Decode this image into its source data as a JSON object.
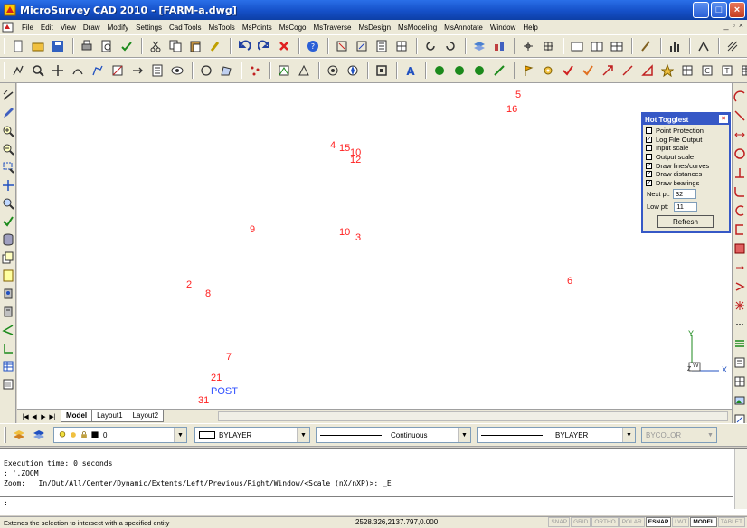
{
  "window": {
    "title": "MicroSurvey CAD 2010 - [FARM-a.dwg]",
    "minimize": "_",
    "maximize": "□",
    "close": "×"
  },
  "menu": [
    "File",
    "Edit",
    "View",
    "Draw",
    "Modify",
    "Settings",
    "Cad Tools",
    "MsTools",
    "MsPoints",
    "MsCogo",
    "MsTraverse",
    "MsDesign",
    "MsModeling",
    "MsAnnotate",
    "Window",
    "Help"
  ],
  "mdi_controls": {
    "minimize": "_",
    "restore": "▫",
    "close": "×"
  },
  "canvas": {
    "points": [
      {
        "label": "5",
        "color": "#ff2020"
      },
      {
        "label": "16",
        "color": "#ff2020"
      },
      {
        "label": "4",
        "color": "#ff2020"
      },
      {
        "label": "15",
        "color": "#ff2020"
      },
      {
        "label": "10",
        "color": "#ff2020"
      },
      {
        "label": "12",
        "color": "#ff2020"
      },
      {
        "label": "9",
        "color": "#ff2020"
      },
      {
        "label": "10",
        "color": "#ff2020"
      },
      {
        "label": "3",
        "color": "#ff2020"
      },
      {
        "label": "2",
        "color": "#ff2020"
      },
      {
        "label": "8",
        "color": "#ff2020"
      },
      {
        "label": "6",
        "color": "#ff2020"
      },
      {
        "label": "7",
        "color": "#ff2020"
      },
      {
        "label": "21",
        "color": "#ff2020"
      },
      {
        "label": "POST",
        "color": "#3050ff"
      },
      {
        "label": "31",
        "color": "#ff2020"
      }
    ],
    "ucs": {
      "y_label": "Y",
      "x_label": "X",
      "w_label": "W",
      "z_label": "Z"
    }
  },
  "tabs": {
    "nav": [
      "|◀",
      "◀",
      "▶",
      "▶|"
    ],
    "items": [
      "Model",
      "Layout1",
      "Layout2"
    ],
    "active": "Model"
  },
  "properties": {
    "layer": "0",
    "color": "BYLAYER",
    "linetype": "Continuous",
    "lineweight": "BYLAYER",
    "plotstyle": "BYCOLOR"
  },
  "command": {
    "lines": [
      "Execution time: 0 seconds",
      ": '.ZOOM",
      "Zoom:   In/Out/All/Center/Dynamic/Extents/Left/Previous/Right/Window/<Scale (nX/nXP)>: _E"
    ],
    "prompt": ":"
  },
  "status": {
    "message": "Extends the selection to intersect with a specified entity",
    "coordinates": "2528.326,2137.797,0.000",
    "buttons": [
      {
        "label": "SNAP",
        "on": false
      },
      {
        "label": "GRID",
        "on": false
      },
      {
        "label": "ORTHO",
        "on": false
      },
      {
        "label": "POLAR",
        "on": false
      },
      {
        "label": "ESNAP",
        "on": true
      },
      {
        "label": "LWT",
        "on": false
      },
      {
        "label": "MODEL",
        "on": true
      },
      {
        "label": "TABLET",
        "on": false
      }
    ]
  },
  "palette": {
    "title": "Hot Togglest",
    "close": "×",
    "options": [
      {
        "label": "Point Protection",
        "checked": false
      },
      {
        "label": "Log File Output",
        "checked": true
      },
      {
        "label": "Input scale",
        "checked": false
      },
      {
        "label": "Output scale",
        "checked": false
      },
      {
        "label": "Draw lines/curves",
        "checked": true
      },
      {
        "label": "Draw distances",
        "checked": true
      },
      {
        "label": "Draw bearings",
        "checked": true
      }
    ],
    "next_pt_label": "Next pt:",
    "next_pt_value": "32",
    "low_pt_label": "Low pt:",
    "low_pt_value": "11",
    "refresh_label": "Refresh"
  },
  "check_glyph": "✓"
}
